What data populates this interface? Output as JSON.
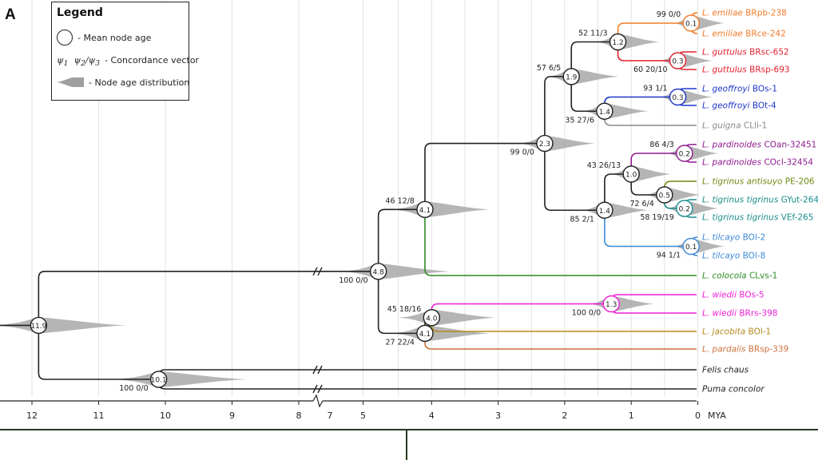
{
  "panel_letter": "A",
  "legend": {
    "title": "Legend",
    "items": [
      {
        "icon": "circle-icon",
        "label": "- Mean node age"
      },
      {
        "icon": "psi-vector-icon",
        "label": "- Concordance vector"
      },
      {
        "icon": "distribution-icon",
        "label": "- Node age distribution"
      }
    ]
  },
  "axis": {
    "unit": "MYA",
    "ticks": [
      "12",
      "11",
      "10",
      "9",
      "8",
      "7",
      "5",
      "4",
      "3",
      "2",
      "1",
      "0"
    ]
  },
  "colors": {
    "emiliae": "#f07c2a",
    "guttulus": "#e0202e",
    "geoffroyi": "#1d36c8",
    "guigna": "#8a8a8a",
    "pardinoides": "#8e1a8e",
    "tigrinus_antisuyo": "#6f8a12",
    "tigrinus_tigrinus": "#198c8c",
    "tilcayo": "#3e88d8",
    "colocola": "#2e8b22",
    "wiedii": "#ec1fd6",
    "jacobita": "#b58a1d",
    "pardalis": "#c8723a",
    "outgroup": "#222222",
    "distribution": "#a8a8a8"
  },
  "tips": [
    {
      "genus": "L.",
      "species": "emiliae",
      "code": "BRpb-238",
      "color_key": "emiliae"
    },
    {
      "genus": "L.",
      "species": "emiliae",
      "code": "BRce-242",
      "color_key": "emiliae"
    },
    {
      "genus": "L.",
      "species": "guttulus",
      "code": "BRsc-652",
      "color_key": "guttulus"
    },
    {
      "genus": "L.",
      "species": "guttulus",
      "code": "BRsp-693",
      "color_key": "guttulus"
    },
    {
      "genus": "L.",
      "species": "geoffroyi",
      "code": "BOs-1",
      "color_key": "geoffroyi"
    },
    {
      "genus": "L.",
      "species": "geoffroyi",
      "code": "BOt-4",
      "color_key": "geoffroyi"
    },
    {
      "genus": "L.",
      "species": "guigna",
      "code": "CLli-1",
      "color_key": "guigna"
    },
    {
      "genus": "L.",
      "species": "pardinoides",
      "code": "COan-32451",
      "color_key": "pardinoides"
    },
    {
      "genus": "L.",
      "species": "pardinoides",
      "code": "COcl-32454",
      "color_key": "pardinoides"
    },
    {
      "genus": "L.",
      "species": "tigrinus antisuyo",
      "code": "PE-206",
      "color_key": "tigrinus_antisuyo"
    },
    {
      "genus": "L.",
      "species": "tigrinus tigrinus",
      "code": "GYut-264",
      "color_key": "tigrinus_tigrinus"
    },
    {
      "genus": "L.",
      "species": "tigrinus tigrinus",
      "code": "VEf-265",
      "color_key": "tigrinus_tigrinus"
    },
    {
      "genus": "L.",
      "species": "tilcayo",
      "code": "BOl-2",
      "color_key": "tilcayo"
    },
    {
      "genus": "L.",
      "species": "tilcayo",
      "code": "BOl-8",
      "color_key": "tilcayo"
    },
    {
      "genus": "L.",
      "species": "colocola",
      "code": "CLvs-1",
      "color_key": "colocola"
    },
    {
      "genus": "L.",
      "species": "wiedii",
      "code": "BOs-5",
      "color_key": "wiedii"
    },
    {
      "genus": "L.",
      "species": "wiedii",
      "code": "BRrs-398",
      "color_key": "wiedii"
    },
    {
      "genus": "L.",
      "species": "jacobita",
      "code": "BOl-1",
      "color_key": "jacobita"
    },
    {
      "genus": "L.",
      "species": "pardalis",
      "code": "BRsp-339",
      "color_key": "pardalis"
    },
    {
      "genus": "",
      "species": "Felis chaus",
      "code": "",
      "color_key": "outgroup"
    },
    {
      "genus": "",
      "species": "Puma concolor",
      "code": "",
      "color_key": "outgroup"
    }
  ],
  "nodes": [
    {
      "id": "root",
      "age": 11.9,
      "label": "11.9",
      "concordance": "",
      "children": [
        "felidae_split",
        "n4_8"
      ],
      "color_key": "outgroup"
    },
    {
      "id": "felidae_split",
      "age": 10.1,
      "label": "10.1",
      "concordance": "100 0/0",
      "children": [
        "tip19",
        "tip20"
      ],
      "color_key": "outgroup"
    },
    {
      "id": "n4_8",
      "age": 4.8,
      "label": "4.8",
      "concordance": "100 0/0",
      "children": [
        "n4_1top",
        "n4_1b"
      ],
      "color_key": "outgroup"
    },
    {
      "id": "n4_1top",
      "age": 4.1,
      "label": "4.1",
      "concordance": "46 12/8",
      "children": [
        "n2_3",
        "tip14"
      ],
      "color_key": "outgroup"
    },
    {
      "id": "n2_3",
      "age": 2.3,
      "label": "2.3",
      "concordance": "99 0/0",
      "children": [
        "n1_9",
        "n1_4b"
      ],
      "color_key": "outgroup"
    },
    {
      "id": "n1_9",
      "age": 1.9,
      "label": "1.9",
      "concordance": "57 6/5",
      "children": [
        "n1_2",
        "n1_4a"
      ],
      "color_key": "outgroup"
    },
    {
      "id": "n1_2",
      "age": 1.2,
      "label": "1.2",
      "concordance": "52 11/3",
      "children": [
        "n0_1a",
        "n0_3a"
      ],
      "color_key": "outgroup"
    },
    {
      "id": "n0_1a",
      "age": 0.1,
      "label": "0.1",
      "concordance": "99 0/0",
      "children": [
        "tip0",
        "tip1"
      ],
      "color_key": "emiliae"
    },
    {
      "id": "n0_3a",
      "age": 0.3,
      "label": "0.3",
      "concordance": "60 20/10",
      "children": [
        "tip2",
        "tip3"
      ],
      "color_key": "guttulus"
    },
    {
      "id": "n1_4a",
      "age": 1.4,
      "label": "1.4",
      "concordance": "35 27/6",
      "children": [
        "n0_3b",
        "tip6"
      ],
      "color_key": "outgroup"
    },
    {
      "id": "n0_3b",
      "age": 0.3,
      "label": "0.3",
      "concordance": "93 1/1",
      "children": [
        "tip4",
        "tip5"
      ],
      "color_key": "geoffroyi"
    },
    {
      "id": "n1_4b",
      "age": 1.4,
      "label": "1.4",
      "concordance": "85 2/1",
      "children": [
        "n1_0",
        "n0_1c"
      ],
      "color_key": "outgroup"
    },
    {
      "id": "n1_0",
      "age": 1.0,
      "label": "1.0",
      "concordance": "43 26/13",
      "children": [
        "n0_2a",
        "n0_5"
      ],
      "color_key": "outgroup"
    },
    {
      "id": "n0_2a",
      "age": 0.2,
      "label": "0.2",
      "concordance": "86 4/3",
      "children": [
        "tip7",
        "tip8"
      ],
      "color_key": "pardinoides"
    },
    {
      "id": "n0_5",
      "age": 0.5,
      "label": "0.5",
      "concordance": "72 6/4",
      "children": [
        "tip9",
        "n0_2b"
      ],
      "color_key": "outgroup"
    },
    {
      "id": "n0_2b",
      "age": 0.2,
      "label": "0.2",
      "concordance": "58 19/19",
      "children": [
        "tip10",
        "tip11"
      ],
      "color_key": "tigrinus_tigrinus"
    },
    {
      "id": "n0_1c",
      "age": 0.1,
      "label": "0.1",
      "concordance": "94 1/1",
      "children": [
        "tip12",
        "tip13"
      ],
      "color_key": "tilcayo"
    },
    {
      "id": "n4_1b",
      "age": 4.1,
      "label": "4.1",
      "concordance": "27 22/4",
      "children": [
        "n4_0",
        "tip18"
      ],
      "color_key": "outgroup"
    },
    {
      "id": "n4_0",
      "age": 4.0,
      "label": "4.0",
      "concordance": "45 18/16",
      "children": [
        "n1_3",
        "tip17"
      ],
      "color_key": "outgroup"
    },
    {
      "id": "n1_3",
      "age": 1.3,
      "label": "1.3",
      "concordance": "100 0/0",
      "children": [
        "tip15",
        "tip16"
      ],
      "color_key": "wiedii"
    }
  ]
}
